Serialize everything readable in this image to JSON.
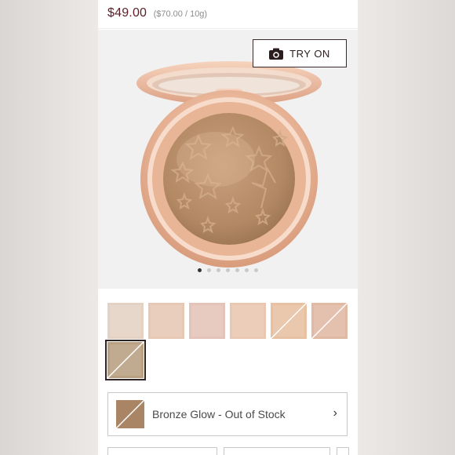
{
  "product": {
    "price": "$49.00",
    "unit_price": "($70.00 / 10g)"
  },
  "hero": {
    "try_on_label": "TRY ON",
    "try_on_icon": "camera-icon",
    "carousel_dots": 7,
    "active_dot": 0
  },
  "swatches": [
    {
      "name": "swatch-1",
      "color": "#e3d2c3",
      "out_of_stock": false,
      "selected": false
    },
    {
      "name": "swatch-2",
      "color": "#e6c8b4",
      "out_of_stock": false,
      "selected": false
    },
    {
      "name": "swatch-3",
      "color": "#e4c3b8",
      "out_of_stock": false,
      "selected": false
    },
    {
      "name": "swatch-4",
      "color": "#e9c7b1",
      "out_of_stock": false,
      "selected": false
    },
    {
      "name": "swatch-5",
      "color": "#e8c1a2",
      "out_of_stock": true,
      "selected": false
    },
    {
      "name": "swatch-6",
      "color": "#e0b9a3",
      "out_of_stock": true,
      "selected": false
    },
    {
      "name": "swatch-7",
      "color": "#b9a081",
      "out_of_stock": true,
      "selected": true
    }
  ],
  "shade_selector": {
    "label": "Bronze Glow - Out of Stock",
    "color": "#a98566"
  },
  "colors": {
    "price": "#5a1f28",
    "compact_rose_gold": "#e9b99b",
    "powder": "#b98d68"
  }
}
